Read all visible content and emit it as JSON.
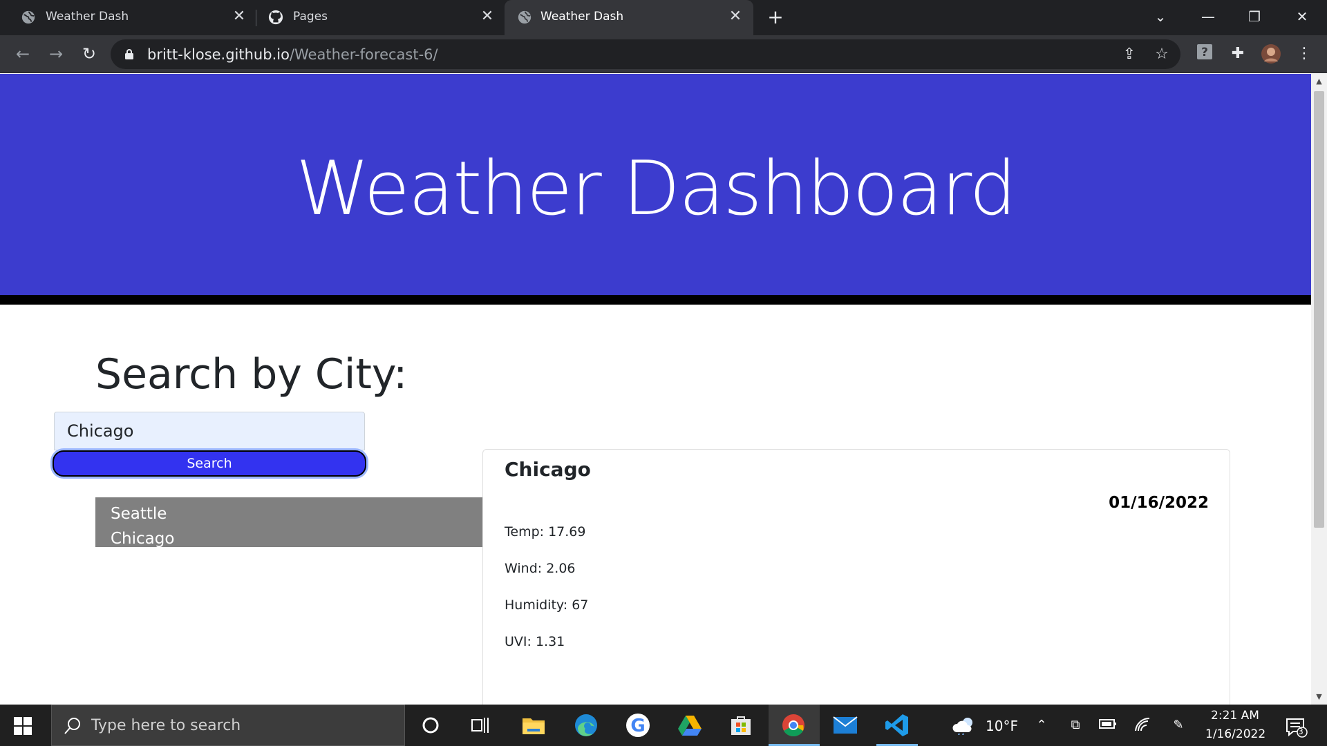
{
  "browser": {
    "tabs": [
      {
        "title": "Weather Dash",
        "favicon": "globe-icon",
        "active": false
      },
      {
        "title": "Pages",
        "favicon": "github-icon",
        "active": false
      },
      {
        "title": "Weather Dash",
        "favicon": "globe-icon",
        "active": true
      }
    ],
    "url_host": "britt-klose.github.io",
    "url_path": "/Weather-forecast-6/"
  },
  "page": {
    "title": "Weather Dashboard",
    "search_heading": "Search by City:",
    "search_input_value": "Chicago",
    "search_button_label": "Search",
    "history": [
      "Seattle",
      "Chicago"
    ],
    "current": {
      "city": "Chicago",
      "date": "01/16/2022",
      "temp": "Temp: 17.69",
      "wind": "Wind: 2.06",
      "humidity": "Humidity: 67",
      "uvi": "UVI: 1.31"
    }
  },
  "taskbar": {
    "search_placeholder": "Type here to search",
    "weather": "10°F",
    "time": "2:21 AM",
    "date": "1/16/2022",
    "notifications": "3"
  },
  "colors": {
    "hero": "#3c3cce",
    "search_button": "#3333f0",
    "history_bg": "#808080"
  }
}
